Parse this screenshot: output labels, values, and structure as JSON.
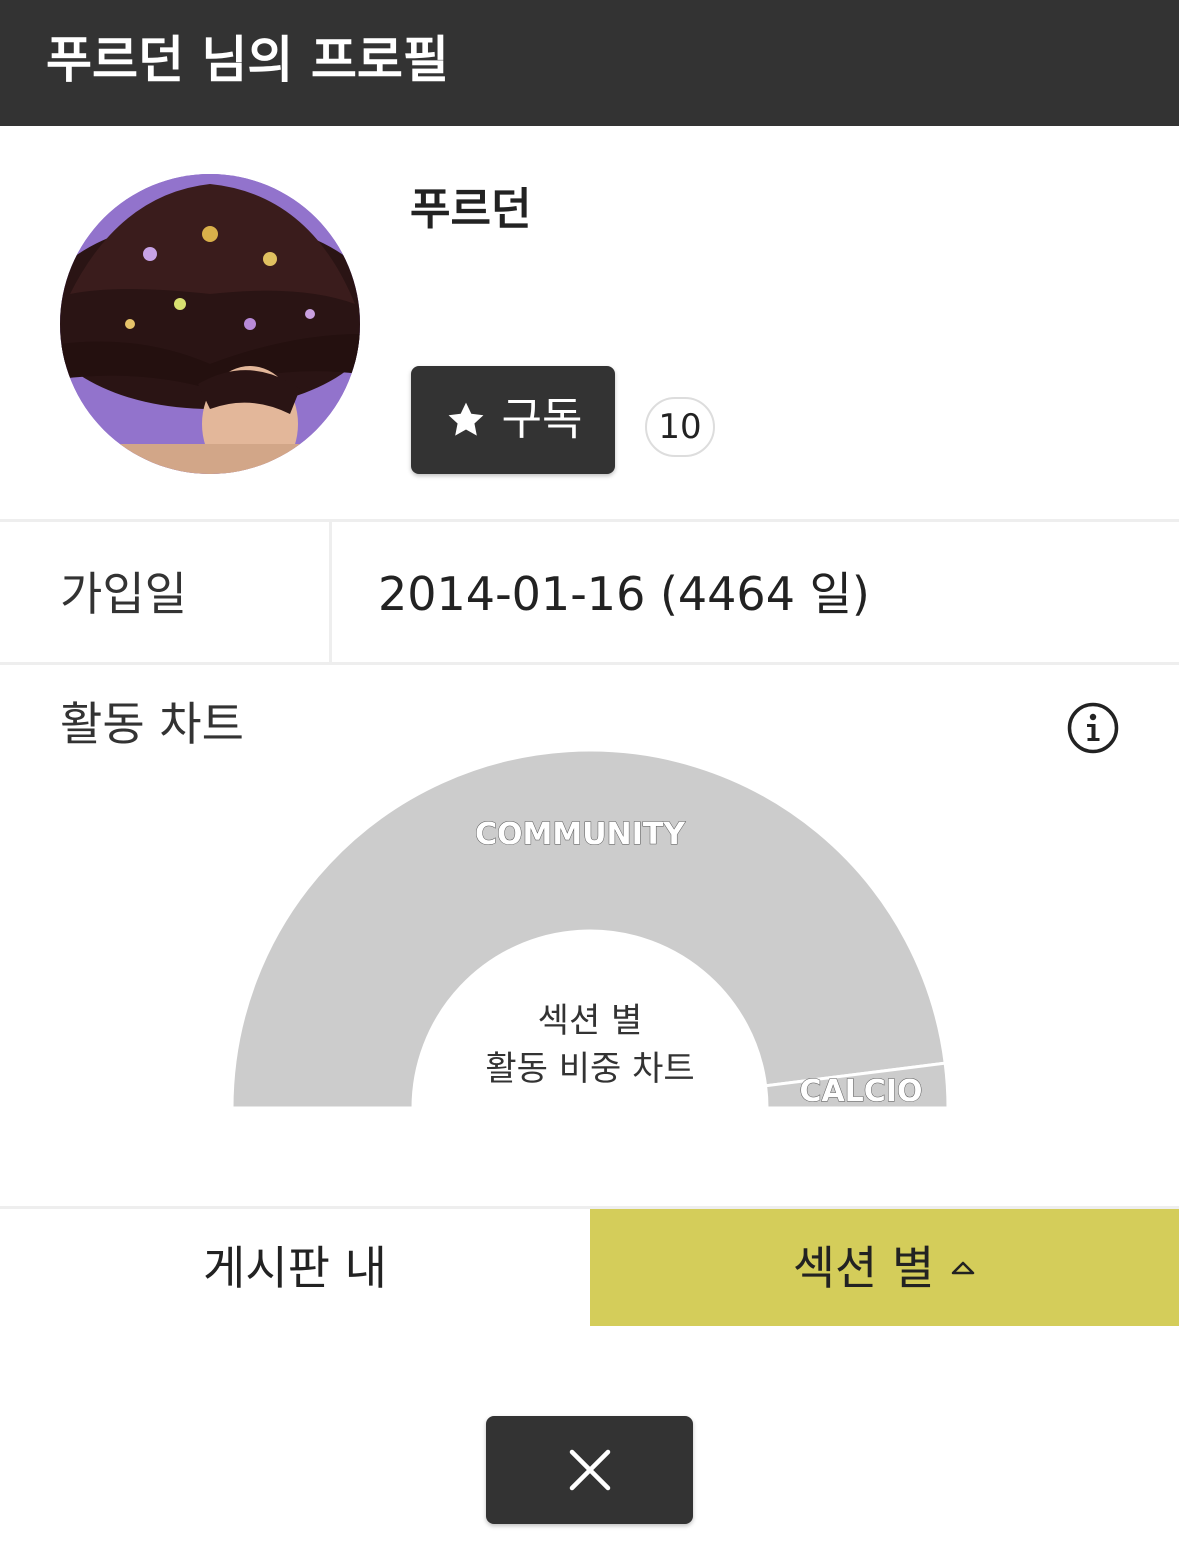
{
  "header": {
    "title": "푸르던 님의 프로필"
  },
  "profile": {
    "username": "푸르던",
    "subscribe_label": "구독",
    "subscriber_count": "10"
  },
  "info": {
    "join_label": "가입일",
    "join_value": "2014-01-16 (4464 일)"
  },
  "activity": {
    "title": "활동 차트",
    "center_line1": "섹션 별",
    "center_line2": "활동 비중 차트"
  },
  "chart_data": {
    "type": "pie",
    "style": "half-donut",
    "categories": [
      "COMMUNITY",
      "CALCIO"
    ],
    "values": [
      96,
      4
    ],
    "unit": "%",
    "colors": [
      "#cccccc",
      "#cccccc"
    ]
  },
  "tabs": {
    "left_label": "게시판 내",
    "right_label": "섹션 별"
  },
  "colors": {
    "header_bg": "#333333",
    "active_tab": "#d4cd5a",
    "slice": "#cccccc"
  },
  "icons": {
    "subscribe": "star-icon",
    "info": "info-icon",
    "tab_caret": "caret-up-icon",
    "close": "close-icon"
  }
}
